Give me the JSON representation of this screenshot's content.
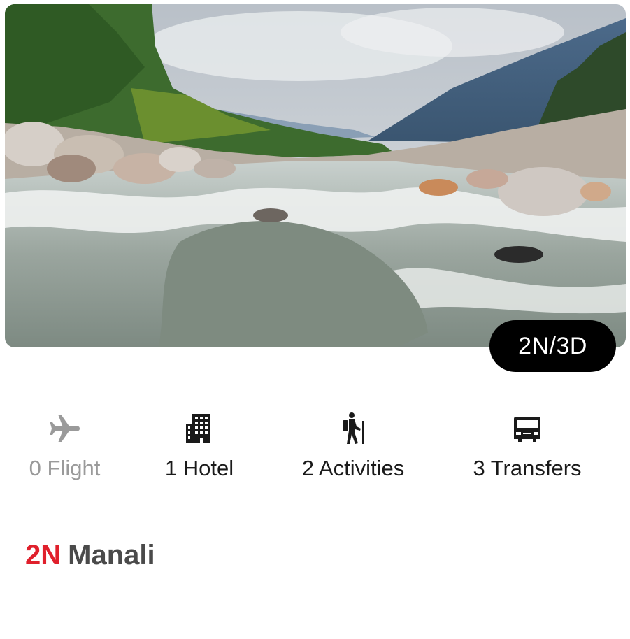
{
  "hero": {
    "image_description_icon": "river-landscape-image",
    "duration_badge": "2N/3D"
  },
  "features": [
    {
      "icon": "airplane-icon",
      "label": "0 Flight",
      "available": false
    },
    {
      "icon": "hotel-building-icon",
      "label": "1 Hotel",
      "available": true
    },
    {
      "icon": "hiker-icon",
      "label": "2 Activities",
      "available": true
    },
    {
      "icon": "car-icon",
      "label": "3 Transfers",
      "available": true
    }
  ],
  "destination": {
    "nights": "2N",
    "city": "Manali"
  },
  "colors": {
    "nights_accent": "#e0202c",
    "city_text": "#4a4a4a",
    "muted_text": "#9a9a9a",
    "badge_bg": "#000000"
  }
}
